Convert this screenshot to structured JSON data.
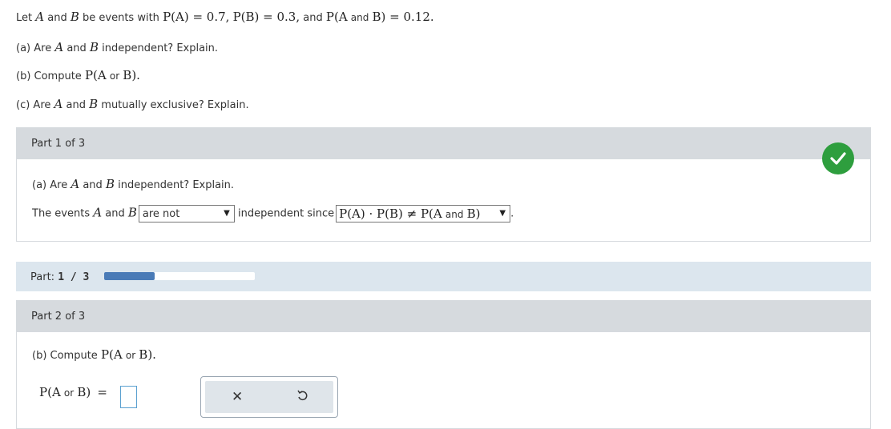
{
  "problem": {
    "intro": {
      "lead": "Let",
      "A": "A",
      "and": "and",
      "B": "B",
      "be": "be events with",
      "pa": "P(A) = 0.7,",
      "pb": "P(B) = 0.3,",
      "and2": "and",
      "pab_prefix": "P(A",
      "pab_and": "and",
      "pab_suffix": "B) = 0.12."
    },
    "a": {
      "label": "(a) Are",
      "A": "A",
      "and": "and",
      "B": "B",
      "rest": "independent? Explain."
    },
    "b": {
      "label": "(b) Compute",
      "expr_prefix": "P(A",
      "or": "or",
      "expr_suffix": "B)."
    },
    "c": {
      "label": "(c) Are",
      "A": "A",
      "and": "and",
      "B": "B",
      "rest": "mutually exclusive? Explain."
    }
  },
  "part1": {
    "header": "Part 1 of 3",
    "question": {
      "label": "(a) Are",
      "A": "A",
      "and": "and",
      "B": "B",
      "rest": "independent? Explain."
    },
    "answer": {
      "prefix": "The events",
      "A": "A",
      "and": "and",
      "B": "B",
      "select1_value": "are not",
      "middle": "independent since",
      "select2_value_prefix": "P(A) · P(B) ≠ P(A",
      "select2_and": "and",
      "select2_value_suffix": "B)",
      "period": "."
    }
  },
  "progress": {
    "label": "Part:",
    "current": "1 / 3",
    "fraction": 0.3333
  },
  "part2": {
    "header": "Part 2 of 3",
    "question": {
      "label": "(b) Compute",
      "expr_prefix": "P(A",
      "or": "or",
      "expr_suffix": "B)."
    },
    "answer": {
      "lhs_prefix": "P(A",
      "or": "or",
      "lhs_suffix": "B)",
      "equals": "="
    }
  },
  "icons": {
    "correct": "check-circle-icon",
    "clear": "x-icon",
    "undo": "undo-icon"
  },
  "colors": {
    "correct_green": "#2e9e3e",
    "progress_fill": "#4a7bb7",
    "header_bg": "#d6dade",
    "progress_bg": "#dce6ee"
  }
}
